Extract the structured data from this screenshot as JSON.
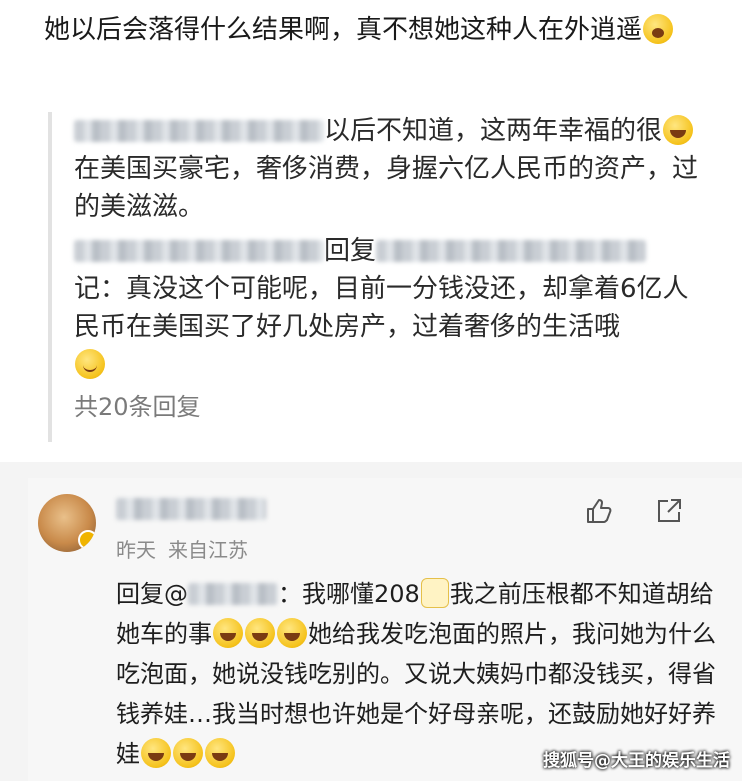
{
  "post": {
    "text_1": "她以后会落得什么结果啊，真不想她这种人在外逍遥",
    "quote_1_suffix": "以后不知道，这两年幸福的很",
    "quote_1_rest": "在美国买豪宅，奢侈消费，身握六亿人民币的资产，过的美滋滋。",
    "quote_2_reply_word": "回复",
    "quote_2_text": "记：真没这个可能呢，目前一分钱没还，却拿着6亿人民币在美国买了好几处房产，过着奢侈的生活哦",
    "reply_count": "共20条回复"
  },
  "comment": {
    "time": "昨天",
    "location": "来自江苏",
    "reply_prefix": "回复@",
    "reply_text_1": "：我哪懂208",
    "reply_text_2": "我之前压根都不知道胡给她车的事",
    "reply_text_3": "她给我发吃泡面的照片，我问她为什么吃泡面，她说没钱吃别的。又说大姨妈巾都没钱买，得省钱养娃…我当时想也许她是个好母亲呢，还鼓励她好好养娃",
    "icons": [
      "thumb-up-icon",
      "share-icon"
    ]
  },
  "watermark": "搜狐号@大王的娱乐生活"
}
